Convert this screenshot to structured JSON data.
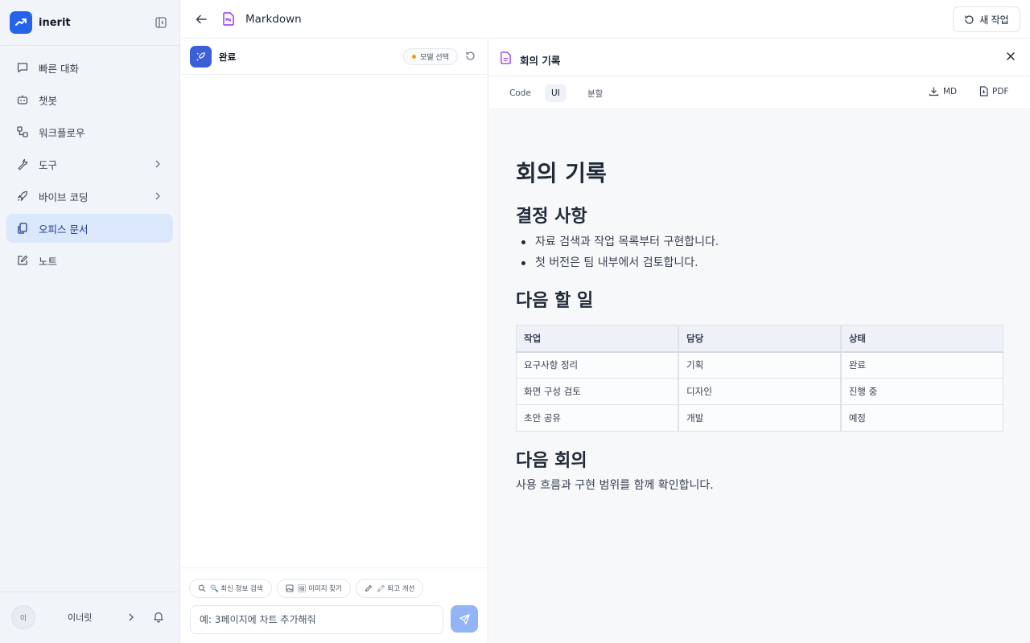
{
  "colors": {
    "accent": "#2563eb",
    "sidebar_active_bg": "#dbe7fb",
    "send_button": "#93b4f5",
    "model_status_dot": "#f59e0b"
  },
  "sidebar": {
    "brand": "inerit",
    "brand_icon": "chart-trend-icon",
    "items": [
      {
        "label": "빠른 대화",
        "icon": "chat-bubble-icon"
      },
      {
        "label": "챗봇",
        "icon": "bot-icon"
      },
      {
        "label": "워크플로우",
        "icon": "workflow-icon"
      },
      {
        "label": "도구",
        "icon": "wrench-icon"
      },
      {
        "label": "바이브 코딩",
        "icon": "rocket-icon"
      },
      {
        "label": "오피스 문서",
        "icon": "documents-icon",
        "active": true
      },
      {
        "label": "노트",
        "icon": "note-edit-icon"
      }
    ],
    "user": {
      "avatar": "이",
      "name": "이너릿"
    }
  },
  "topbar": {
    "title": "Markdown",
    "new_task": "새 작업"
  },
  "chat": {
    "status": "완료",
    "model_select": "모델 선택",
    "chips": [
      {
        "label": "🔍 최신 정보 검색",
        "icon": "search-icon"
      },
      {
        "label": "🖼 이미지 찾기",
        "icon": "image-icon"
      },
      {
        "label": "🖍 퇴고 개선",
        "icon": "pencil-icon"
      }
    ],
    "input_placeholder": "예: 3페이지에 차트 추가해줘"
  },
  "preview": {
    "title": "회의 기록",
    "tabs": [
      "Code",
      "UI",
      "분할"
    ],
    "active_tab": "UI",
    "export_md": "MD",
    "export_pdf": "PDF",
    "doc": {
      "h1": "회의 기록",
      "decisions_heading": "결정 사항",
      "decisions": [
        "자료 검색과 작업 목록부터 구현합니다.",
        "첫 버전은 팀 내부에서 검토합니다."
      ],
      "todo_heading": "다음 할 일",
      "table": {
        "headers": [
          "작업",
          "담당",
          "상태"
        ],
        "rows": [
          [
            "요구사항 정리",
            "기획",
            "완료"
          ],
          [
            "화면 구성 검토",
            "디자인",
            "진행 중"
          ],
          [
            "초안 공유",
            "개발",
            "예정"
          ]
        ]
      },
      "next_heading": "다음 회의",
      "next_text": "사용 흐름과 구현 범위를 함께 확인합니다."
    }
  }
}
